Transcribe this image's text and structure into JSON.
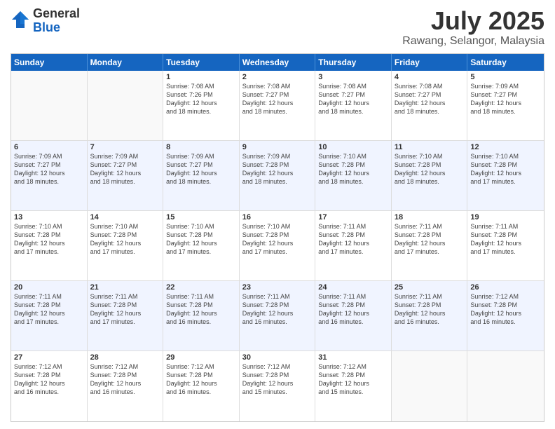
{
  "logo": {
    "general": "General",
    "blue": "Blue"
  },
  "title": {
    "month_year": "July 2025",
    "location": "Rawang, Selangor, Malaysia"
  },
  "header_days": [
    "Sunday",
    "Monday",
    "Tuesday",
    "Wednesday",
    "Thursday",
    "Friday",
    "Saturday"
  ],
  "weeks": [
    [
      {
        "day": "",
        "info": ""
      },
      {
        "day": "",
        "info": ""
      },
      {
        "day": "1",
        "info": "Sunrise: 7:08 AM\nSunset: 7:26 PM\nDaylight: 12 hours\nand 18 minutes."
      },
      {
        "day": "2",
        "info": "Sunrise: 7:08 AM\nSunset: 7:27 PM\nDaylight: 12 hours\nand 18 minutes."
      },
      {
        "day": "3",
        "info": "Sunrise: 7:08 AM\nSunset: 7:27 PM\nDaylight: 12 hours\nand 18 minutes."
      },
      {
        "day": "4",
        "info": "Sunrise: 7:08 AM\nSunset: 7:27 PM\nDaylight: 12 hours\nand 18 minutes."
      },
      {
        "day": "5",
        "info": "Sunrise: 7:09 AM\nSunset: 7:27 PM\nDaylight: 12 hours\nand 18 minutes."
      }
    ],
    [
      {
        "day": "6",
        "info": "Sunrise: 7:09 AM\nSunset: 7:27 PM\nDaylight: 12 hours\nand 18 minutes."
      },
      {
        "day": "7",
        "info": "Sunrise: 7:09 AM\nSunset: 7:27 PM\nDaylight: 12 hours\nand 18 minutes."
      },
      {
        "day": "8",
        "info": "Sunrise: 7:09 AM\nSunset: 7:27 PM\nDaylight: 12 hours\nand 18 minutes."
      },
      {
        "day": "9",
        "info": "Sunrise: 7:09 AM\nSunset: 7:28 PM\nDaylight: 12 hours\nand 18 minutes."
      },
      {
        "day": "10",
        "info": "Sunrise: 7:10 AM\nSunset: 7:28 PM\nDaylight: 12 hours\nand 18 minutes."
      },
      {
        "day": "11",
        "info": "Sunrise: 7:10 AM\nSunset: 7:28 PM\nDaylight: 12 hours\nand 18 minutes."
      },
      {
        "day": "12",
        "info": "Sunrise: 7:10 AM\nSunset: 7:28 PM\nDaylight: 12 hours\nand 17 minutes."
      }
    ],
    [
      {
        "day": "13",
        "info": "Sunrise: 7:10 AM\nSunset: 7:28 PM\nDaylight: 12 hours\nand 17 minutes."
      },
      {
        "day": "14",
        "info": "Sunrise: 7:10 AM\nSunset: 7:28 PM\nDaylight: 12 hours\nand 17 minutes."
      },
      {
        "day": "15",
        "info": "Sunrise: 7:10 AM\nSunset: 7:28 PM\nDaylight: 12 hours\nand 17 minutes."
      },
      {
        "day": "16",
        "info": "Sunrise: 7:10 AM\nSunset: 7:28 PM\nDaylight: 12 hours\nand 17 minutes."
      },
      {
        "day": "17",
        "info": "Sunrise: 7:11 AM\nSunset: 7:28 PM\nDaylight: 12 hours\nand 17 minutes."
      },
      {
        "day": "18",
        "info": "Sunrise: 7:11 AM\nSunset: 7:28 PM\nDaylight: 12 hours\nand 17 minutes."
      },
      {
        "day": "19",
        "info": "Sunrise: 7:11 AM\nSunset: 7:28 PM\nDaylight: 12 hours\nand 17 minutes."
      }
    ],
    [
      {
        "day": "20",
        "info": "Sunrise: 7:11 AM\nSunset: 7:28 PM\nDaylight: 12 hours\nand 17 minutes."
      },
      {
        "day": "21",
        "info": "Sunrise: 7:11 AM\nSunset: 7:28 PM\nDaylight: 12 hours\nand 17 minutes."
      },
      {
        "day": "22",
        "info": "Sunrise: 7:11 AM\nSunset: 7:28 PM\nDaylight: 12 hours\nand 16 minutes."
      },
      {
        "day": "23",
        "info": "Sunrise: 7:11 AM\nSunset: 7:28 PM\nDaylight: 12 hours\nand 16 minutes."
      },
      {
        "day": "24",
        "info": "Sunrise: 7:11 AM\nSunset: 7:28 PM\nDaylight: 12 hours\nand 16 minutes."
      },
      {
        "day": "25",
        "info": "Sunrise: 7:11 AM\nSunset: 7:28 PM\nDaylight: 12 hours\nand 16 minutes."
      },
      {
        "day": "26",
        "info": "Sunrise: 7:12 AM\nSunset: 7:28 PM\nDaylight: 12 hours\nand 16 minutes."
      }
    ],
    [
      {
        "day": "27",
        "info": "Sunrise: 7:12 AM\nSunset: 7:28 PM\nDaylight: 12 hours\nand 16 minutes."
      },
      {
        "day": "28",
        "info": "Sunrise: 7:12 AM\nSunset: 7:28 PM\nDaylight: 12 hours\nand 16 minutes."
      },
      {
        "day": "29",
        "info": "Sunrise: 7:12 AM\nSunset: 7:28 PM\nDaylight: 12 hours\nand 16 minutes."
      },
      {
        "day": "30",
        "info": "Sunrise: 7:12 AM\nSunset: 7:28 PM\nDaylight: 12 hours\nand 15 minutes."
      },
      {
        "day": "31",
        "info": "Sunrise: 7:12 AM\nSunset: 7:28 PM\nDaylight: 12 hours\nand 15 minutes."
      },
      {
        "day": "",
        "info": ""
      },
      {
        "day": "",
        "info": ""
      }
    ]
  ]
}
